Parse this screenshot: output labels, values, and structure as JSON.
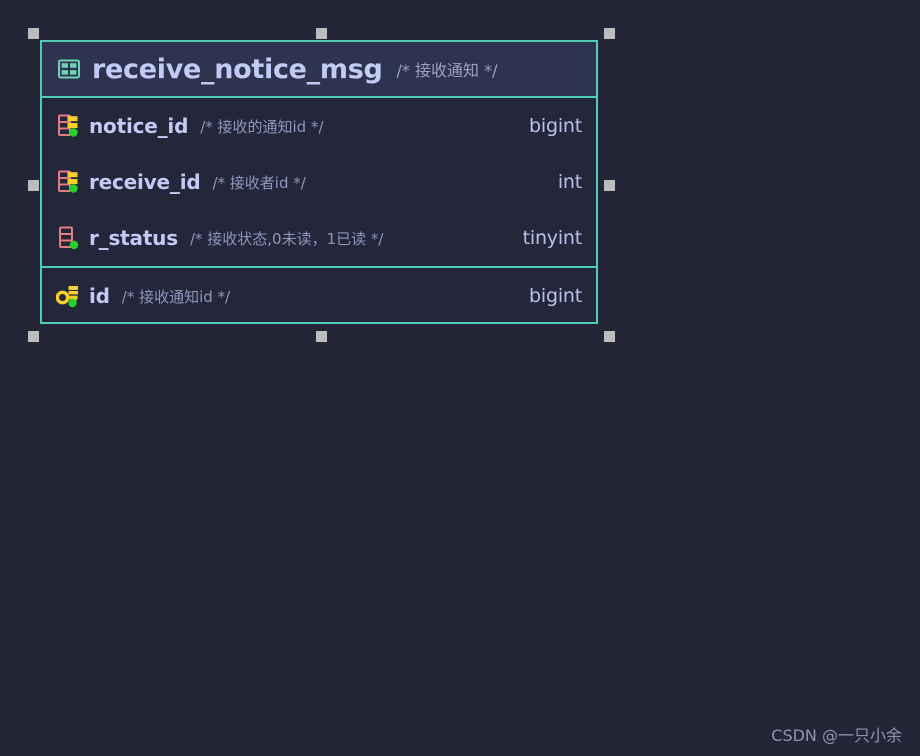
{
  "canvas": {
    "background_color": "#242638"
  },
  "entity": {
    "border_color": "#4ecdb4",
    "header_background": "#2e3350",
    "body_background": "#242639",
    "icon": "table-grid-icon",
    "title": "receive_notice_msg",
    "title_comment": "/* 接收通知 */",
    "columns": [
      {
        "icon": "column-indexed-icon",
        "name": "notice_id",
        "comment": "/* 接收的通知id */",
        "type": "bigint"
      },
      {
        "icon": "column-indexed-icon",
        "name": "receive_id",
        "comment": "/* 接收者id */",
        "type": "int"
      },
      {
        "icon": "column-icon",
        "name": "r_status",
        "comment": "/* 接收状态,0未读，1已读 */",
        "type": "tinyint"
      }
    ],
    "primary_key_columns": [
      {
        "icon": "primary-key-icon",
        "name": "id",
        "comment": "/* 接收通知id */",
        "type": "bigint"
      }
    ]
  },
  "selection": {
    "handle_color": "#bdbdc0",
    "handles": [
      "top-left",
      "top-center",
      "top-right",
      "middle-left",
      "middle-right",
      "bottom-left",
      "bottom-center",
      "bottom-right"
    ]
  },
  "watermark": {
    "text": "CSDN @一只小余"
  }
}
